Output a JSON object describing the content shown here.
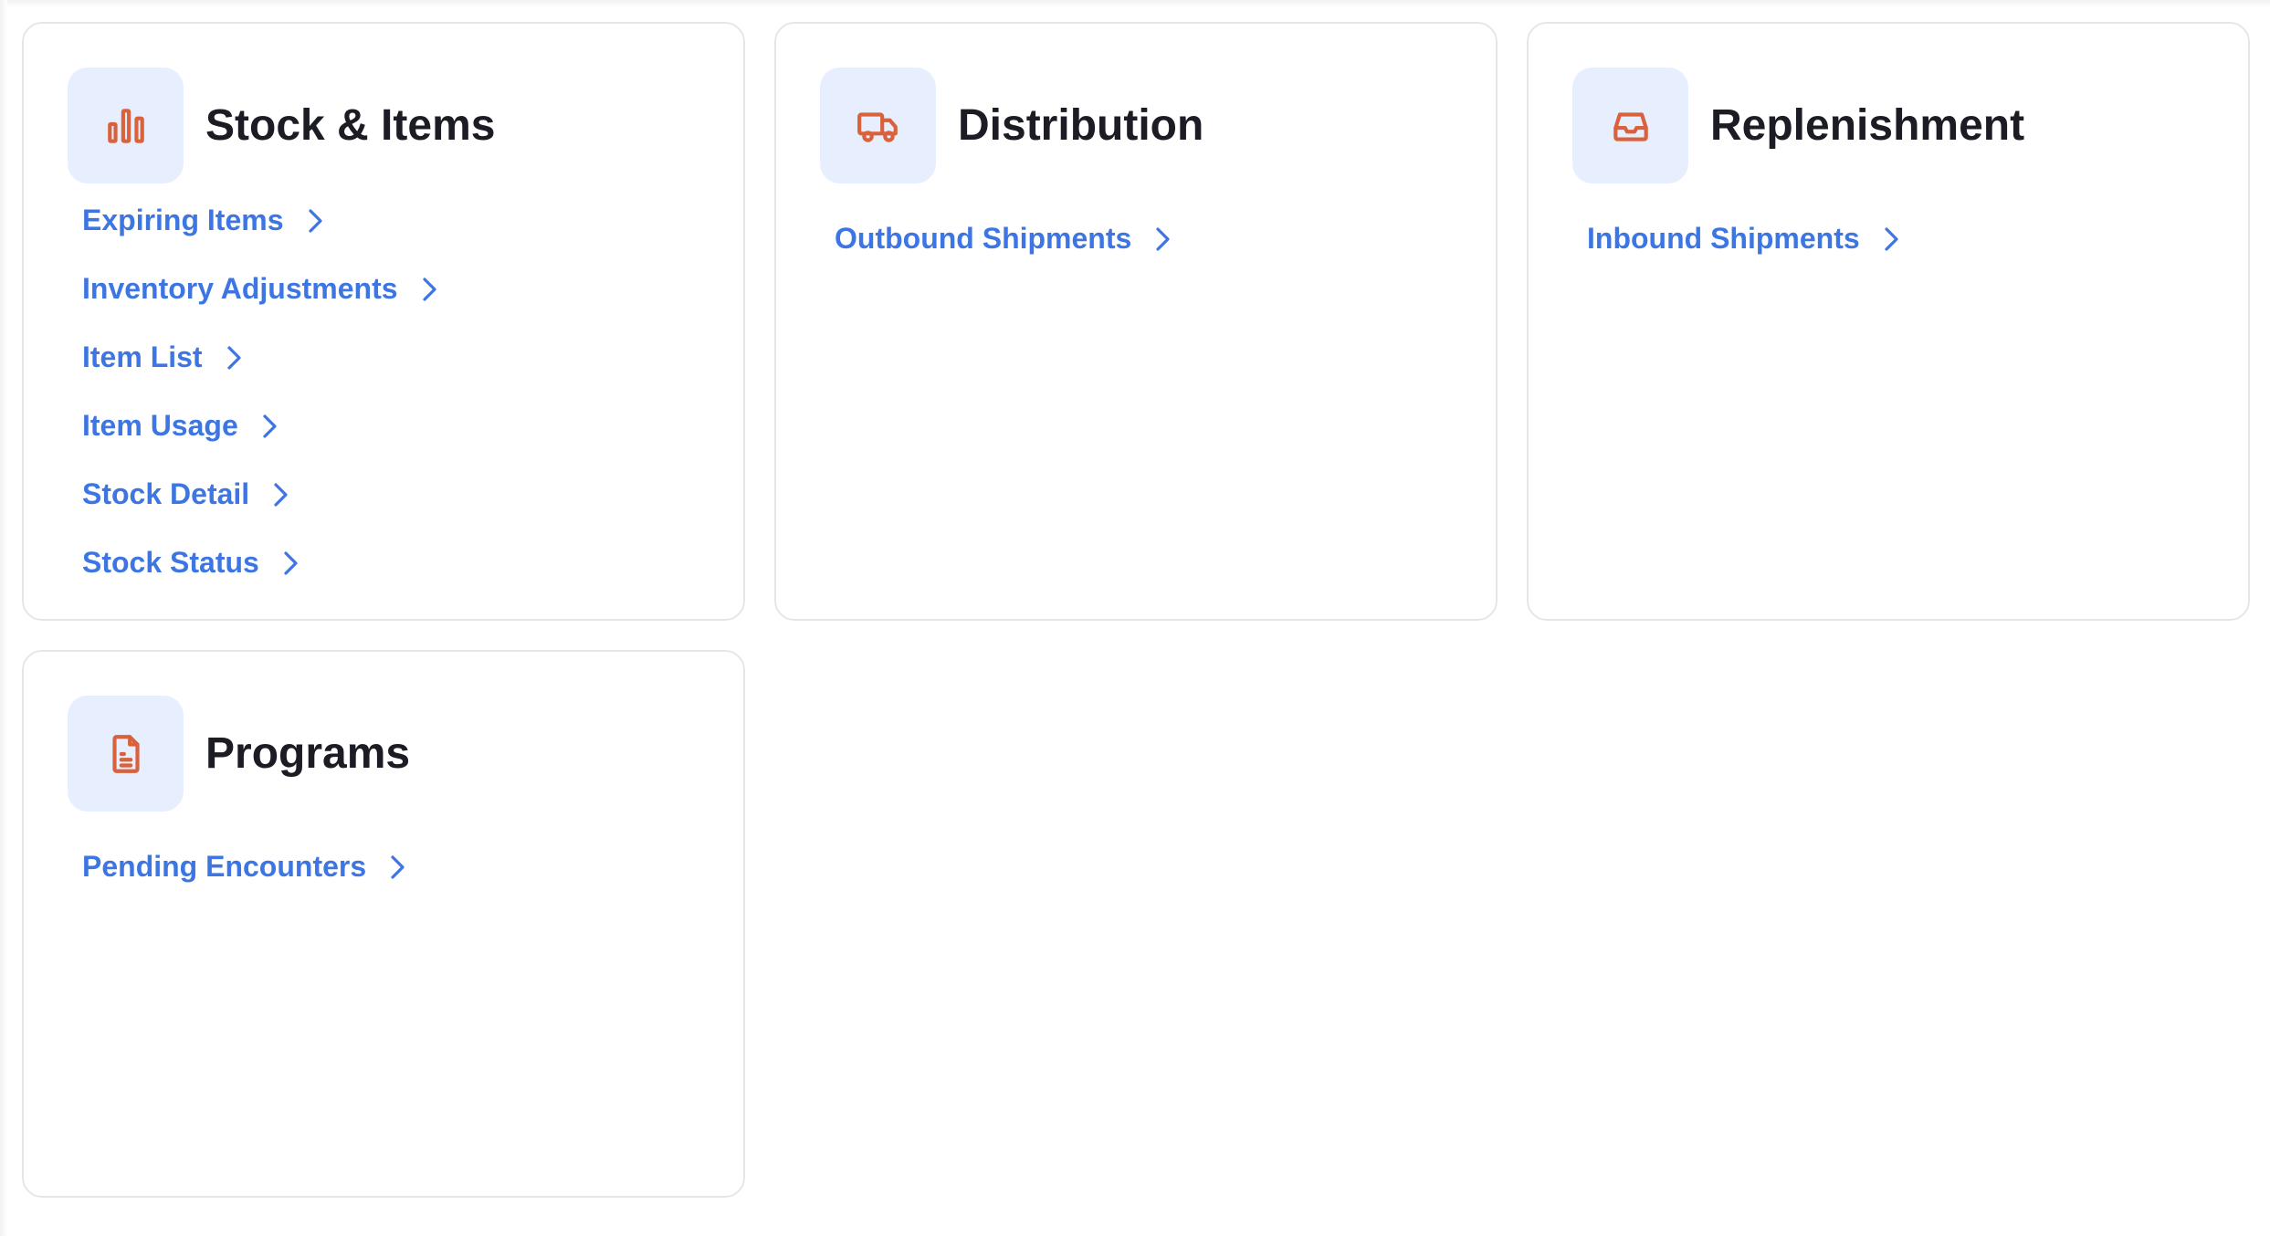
{
  "cards": [
    {
      "title": "Stock & Items",
      "icon": "bar-chart-icon",
      "links": [
        {
          "label": "Expiring Items"
        },
        {
          "label": "Inventory Adjustments"
        },
        {
          "label": "Item List"
        },
        {
          "label": "Item Usage"
        },
        {
          "label": "Stock Detail"
        },
        {
          "label": "Stock Status"
        }
      ]
    },
    {
      "title": "Distribution",
      "icon": "truck-icon",
      "links": [
        {
          "label": "Outbound Shipments"
        }
      ]
    },
    {
      "title": "Replenishment",
      "icon": "inbox-icon",
      "links": [
        {
          "label": "Inbound Shipments"
        }
      ]
    },
    {
      "title": "Programs",
      "icon": "document-icon",
      "links": [
        {
          "label": "Pending Encounters"
        }
      ]
    }
  ],
  "colors": {
    "link": "#3d76e3",
    "icon": "#d9623d",
    "icon_bg": "#e7eefd",
    "title": "#1c1c24",
    "card_border": "#e6e6ea"
  }
}
